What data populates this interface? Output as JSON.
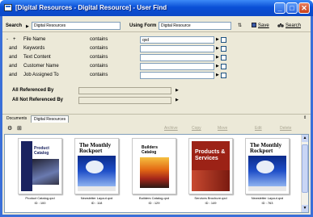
{
  "window": {
    "title": "[Digital Resources - Digital Resource] - User Find",
    "minimize_glyph": "_",
    "maximize_glyph": "□",
    "close_glyph": "✕"
  },
  "topbar": {
    "search_label": "Search",
    "search_target": "Digital Resources",
    "using_form_label": "Using Form",
    "using_form_value": "Digital Resource",
    "options_glyph": "⇅",
    "save_label": "Save",
    "search_button_label": "Search"
  },
  "criteria": {
    "header_minus": "-",
    "header_plus": "+",
    "rows": [
      {
        "conj": "",
        "field": "File Name",
        "op": "contains",
        "value": "qxd"
      },
      {
        "conj": "and",
        "field": "Keywords",
        "op": "contains",
        "value": ""
      },
      {
        "conj": "and",
        "field": "Text Content",
        "op": "contains",
        "value": ""
      },
      {
        "conj": "and",
        "field": "Customer Name",
        "op": "contains",
        "value": ""
      },
      {
        "conj": "and",
        "field": "Job Assigned To",
        "op": "contains",
        "value": ""
      }
    ],
    "referenced_label": "All Referenced By",
    "not_referenced_label": "All Not Referenced By"
  },
  "documents": {
    "tab_documents": "Documents",
    "tab_digital": "Digital Resources",
    "actions": {
      "archive": "Archive",
      "copy": "Copy",
      "move": "Move",
      "edit": "Edit",
      "delete": "Delete"
    },
    "items": [
      {
        "title": "Product Catalog",
        "caption": "Product Catalog.qxd",
        "id": "ID : 100",
        "style": "catalog"
      },
      {
        "title": "The Monthly Rockport",
        "caption": "Newsletter Layout.qxd",
        "id": "ID : 118",
        "style": "news"
      },
      {
        "title": "Builders Catalog",
        "caption": "Builders Catalog.qxd",
        "id": "ID : 129",
        "style": "builders"
      },
      {
        "title": "Products & Services",
        "caption": "Services Brochure.qxd",
        "id": "ID : 149",
        "style": "products"
      },
      {
        "title": "The Monthly Rockport",
        "caption": "Newsletter Layout.qxd",
        "id": "ID : 763",
        "style": "news"
      }
    ]
  }
}
